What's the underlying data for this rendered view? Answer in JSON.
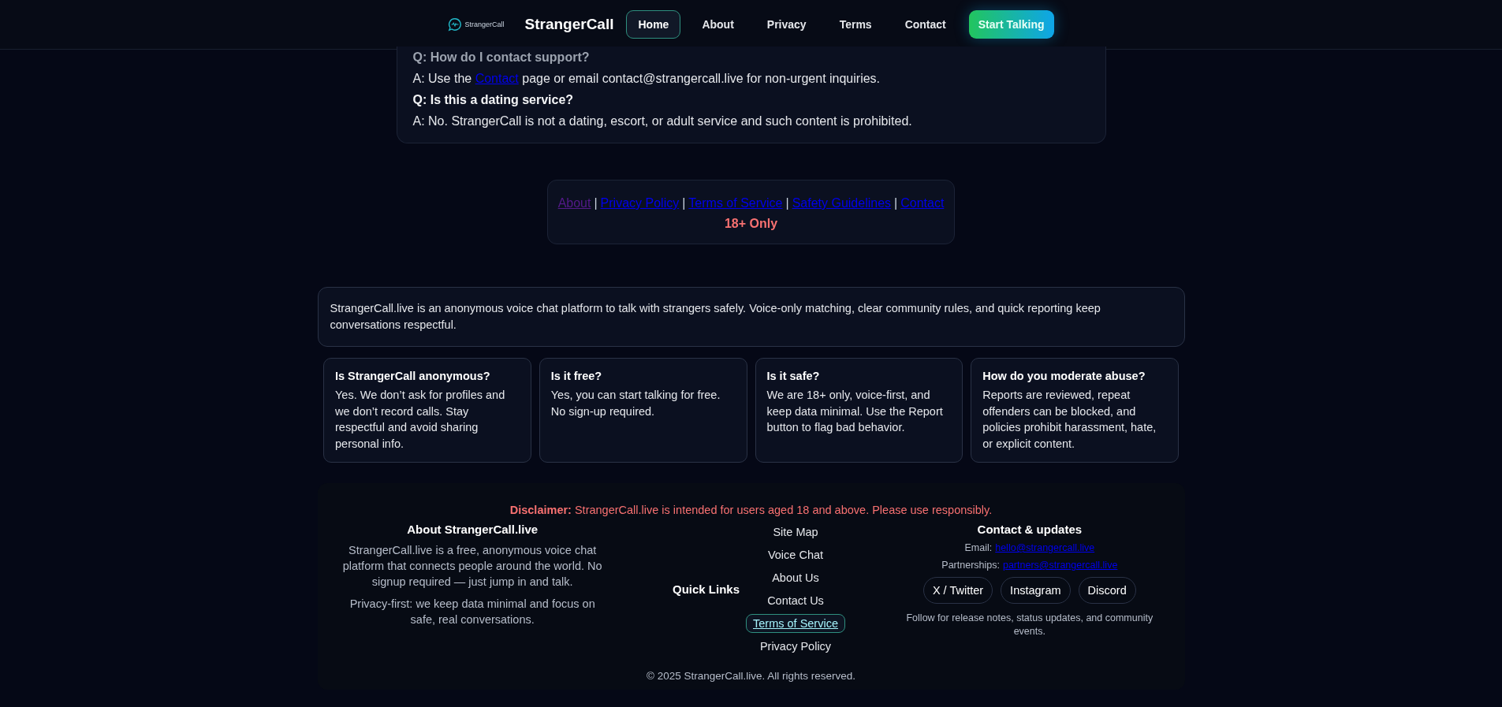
{
  "header": {
    "logo_text": "StrangerCall",
    "brand": "StrangerCall",
    "nav": [
      {
        "label": "Home",
        "selected": true
      },
      {
        "label": "About",
        "selected": false
      },
      {
        "label": "Privacy",
        "selected": false
      },
      {
        "label": "Terms",
        "selected": false
      },
      {
        "label": "Contact",
        "selected": false
      }
    ],
    "cta": "Start Talking"
  },
  "faq": [
    {
      "kind": "question",
      "text": "Q: How do I contact support?"
    },
    {
      "kind": "answer_link",
      "before": "A: Use the ",
      "link": "Contact",
      "after": " page or email contact@strangercall.live for non-urgent inquiries."
    },
    {
      "kind": "question",
      "text": "Q: Is this a dating service?"
    },
    {
      "kind": "answer",
      "text": "A: No. StrangerCall is not a dating, escort, or adult service and such content is prohibited."
    }
  ],
  "footer_links": {
    "links": [
      {
        "label": "About",
        "visited": true
      },
      {
        "label": "Privacy Policy",
        "visited": false
      },
      {
        "label": "Terms of Service",
        "visited": false
      },
      {
        "label": "Safety Guidelines",
        "visited": false
      },
      {
        "label": "Contact",
        "visited": false
      }
    ],
    "separator": "|",
    "age_note": "18+ Only"
  },
  "intro": "StrangerCall.live is an anonymous voice chat platform to talk with strangers safely. Voice-only matching, clear community rules, and quick reporting keep conversations respectful.",
  "cards": [
    {
      "title": "Is StrangerCall anonymous?",
      "text": "Yes. We don’t ask for profiles and we don’t record calls. Stay respectful and avoid sharing personal info."
    },
    {
      "title": "Is it free?",
      "text": "Yes, you can start talking for free. No sign-up required."
    },
    {
      "title": "Is it safe?",
      "text": "We are 18+ only, voice-first, and keep data minimal. Use the Report button to flag bad behavior."
    },
    {
      "title": "How do you moderate abuse?",
      "text": "Reports are reviewed, repeat offenders can be blocked, and policies prohibit harassment, hate, or explicit content."
    }
  ],
  "footer": {
    "disclaimer": "**Disclaimer:** StrangerCall.live is intended for users aged 18 and above. Please use responsibly.",
    "about": {
      "title": "About StrangerCall.live",
      "paragraphs": [
        "StrangerCall.live is a free, anonymous voice chat platform that connects people around the world. No signup required — just jump in and talk.",
        "Privacy-first: we keep data minimal and focus on safe, real conversations."
      ]
    },
    "quick_links": {
      "title": "Quick Links",
      "items": [
        {
          "label": "Site Map",
          "selected": false
        },
        {
          "label": "Voice Chat",
          "selected": false
        },
        {
          "label": "About Us",
          "selected": false
        },
        {
          "label": "Contact Us",
          "selected": false
        },
        {
          "label": "Terms of Service",
          "selected": true
        },
        {
          "label": "Privacy Policy",
          "selected": false
        }
      ]
    },
    "contact": {
      "title": "Contact & updates",
      "lines": [
        {
          "label": "Email:",
          "link": "hello@strangercall.live"
        },
        {
          "label": "Partnerships:",
          "link": "partners@strangercall.live"
        }
      ],
      "socials": [
        "X / Twitter",
        "Instagram",
        "Discord"
      ],
      "note": "Follow for release notes, status updates, and community events."
    },
    "copyright": "© 2025 StrangerCall.live. All rights reserved."
  }
}
